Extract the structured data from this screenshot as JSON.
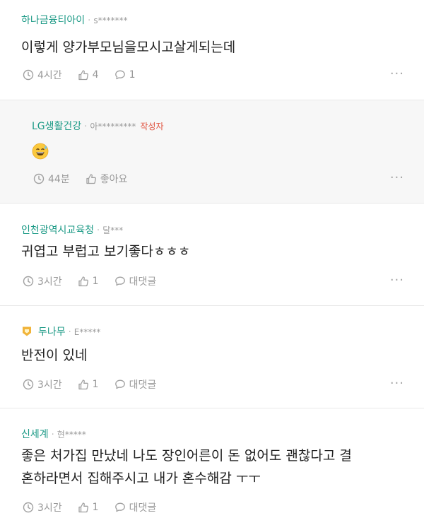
{
  "comments": [
    {
      "company": "하나금융티아이",
      "nickname": "s*******",
      "text": "이렇게 양가부모님을모시고살게되는데",
      "time": "4시간",
      "likes": "4",
      "replies": "1",
      "more": "···"
    },
    {
      "company": "LG생활건강",
      "nickname": "아*********",
      "author_tag": "작성자",
      "emoji": "grinning-sweat-emoji",
      "time": "44분",
      "likes": "좋아요",
      "more": "···"
    },
    {
      "company": "인천광역시교육청",
      "nickname": "달***",
      "text": "귀엽고 부럽고 보기좋다ㅎㅎㅎ",
      "time": "3시간",
      "likes": "1",
      "replies": "대댓글",
      "more": "···"
    },
    {
      "company": "두나무",
      "nickname": "E*****",
      "badge": "gold-badge-icon",
      "text": "반전이 있네",
      "time": "3시간",
      "likes": "1",
      "replies": "대댓글",
      "more": "···"
    },
    {
      "company": "신세계",
      "nickname": "현*****",
      "text_line1": "좋은 처가집 만났네 나도 장인어른이 돈 없어도 괜찮다고 결",
      "text_line2": "혼하라면서 집해주시고 내가 혼수해감 ㅜㅜ",
      "time": "3시간",
      "likes": "1",
      "replies": "대댓글"
    }
  ],
  "colors": {
    "company": "#1c9a86",
    "author_tag": "#e0523f",
    "reply_bg": "#f7f7f7",
    "meta": "#999999"
  }
}
